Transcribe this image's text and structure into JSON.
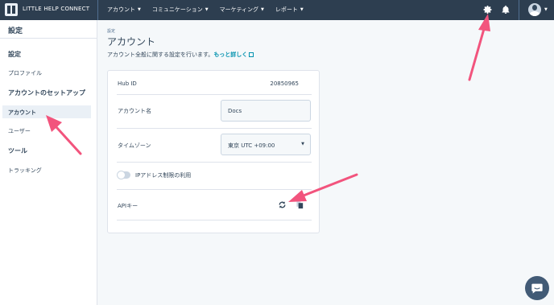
{
  "topbar": {
    "app_title": "LITTLE HELP CONNECT",
    "nav": [
      {
        "label": "アカウント"
      },
      {
        "label": "コミュニケーション"
      },
      {
        "label": "マーケティング"
      },
      {
        "label": "レポート"
      }
    ],
    "icons": [
      "settings-icon",
      "bell-icon",
      "avatar"
    ]
  },
  "sidebar": {
    "header": "設定",
    "sections": [
      {
        "title": "設定",
        "items": [
          "プロファイル"
        ]
      },
      {
        "title": "アカウントのセットアップ",
        "items": [
          "アカウント",
          "ユーザー"
        ]
      },
      {
        "title": "ツール",
        "items": [
          "トラッキング"
        ]
      }
    ],
    "active_item": "アカウント"
  },
  "main": {
    "breadcrumb": "設定",
    "title": "アカウント",
    "description": "アカウント全般に関する設定を行います。",
    "learn_more": "もっと詳しく",
    "card": {
      "hub_id_label": "Hub ID",
      "hub_id_value": "20850965",
      "account_name_label": "アカウント名",
      "account_name_value": "Docs",
      "timezone_label": "タイムゾーン",
      "timezone_value": "東京 UTC +09:00",
      "ip_toggle_label": "IPアドレス制限の利用",
      "ip_toggle_on": false,
      "api_key_label": "APIキー"
    }
  },
  "colors": {
    "topbar": "#2d3e50",
    "link": "#0091ae",
    "annotation_arrow": "#f2547d",
    "active_bg": "#eaf0f6"
  }
}
